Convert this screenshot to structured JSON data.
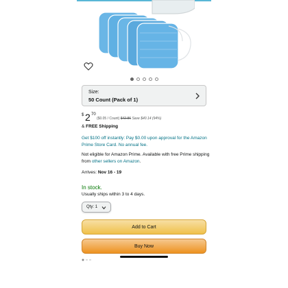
{
  "product": {
    "image_alt": "Disposable face masks"
  },
  "carousel": {
    "total": 5,
    "active_index": 0
  },
  "size": {
    "label": "Size:",
    "value": "50 Count (Pack of 1)"
  },
  "price": {
    "currency": "$",
    "whole": "2",
    "fraction": "70",
    "per_count": "($0.05 / Count)",
    "list_price": "$42.86",
    "savings": "Save $40.14 (94%)"
  },
  "shipping": {
    "prefix": "&",
    "label": "FREE Shipping"
  },
  "promo": {
    "text": "Get $100 off instantly: Pay $0.00 upon approval for the Amazon Prime Store Card. No annual fee."
  },
  "prime_note": {
    "text": "Not eligible for Amazon Prime. Available with free Prime shipping from",
    "link": "other sellers on Amazon",
    "suffix": "."
  },
  "delivery": {
    "label": "Arrives:",
    "dates": "Nov 16 - 19"
  },
  "stock": {
    "status": "In stock.",
    "ships_note": "Usually ships within 3 to 4 days."
  },
  "quantity": {
    "label": "Qty:",
    "value": "1"
  },
  "buttons": {
    "add_to_cart": "Add to Cart",
    "buy_now": "Buy Now"
  },
  "colors": {
    "link": "#007185",
    "in_stock": "#007600",
    "add_to_cart": "#f0c14b",
    "buy_now": "#ed9220"
  },
  "icons": {
    "wishlist": "heart-outline-icon",
    "size_chevron": "chevron-right-icon",
    "qty_chevron": "chevron-down-icon"
  }
}
